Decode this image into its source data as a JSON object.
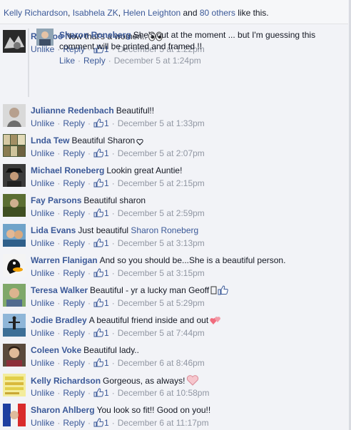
{
  "likes_bar": {
    "names": [
      "Kelly Richardson",
      "Isabhela ZK",
      "Helen Leighton"
    ],
    "sep1": ", ",
    "sep2": ", ",
    "and": " and ",
    "others": "80 others",
    "suffix": " like this."
  },
  "actions": {
    "unlike": "Unlike",
    "reply": "Reply",
    "like": "Like"
  },
  "comments": [
    {
      "author": "Ric Doo",
      "text": "Now that's a women..",
      "likes": "1",
      "date": "December 5 at 1:22pm",
      "emoji": "eyes"
    },
    {
      "author": "Sharon Roneberg",
      "text": "She's out at the moment ... but I'm guessing this comment will be printed and framed !!",
      "date": "December 5 at 1:24pm"
    },
    {
      "author": "Julianne Redenbach",
      "text": "Beautiful!!",
      "likes": "1",
      "date": "December 5 at 1:33pm"
    },
    {
      "author": "Lnda Tew",
      "text": "Beautiful Sharon",
      "likes": "1",
      "date": "December 5 at 2:07pm",
      "emoji": "heart-outline"
    },
    {
      "author": "Michael Roneberg",
      "text": "Lookin great Auntie!",
      "likes": "1",
      "date": "December 5 at 2:15pm"
    },
    {
      "author": "Fay Parsons",
      "text": "Beautiful sharon",
      "likes": "1",
      "date": "December 5 at 2:59pm"
    },
    {
      "author": "Lida Evans",
      "text": "Just beautiful",
      "mention": "Sharon Roneberg",
      "likes": "1",
      "date": "December 5 at 3:13pm"
    },
    {
      "author": "Warren Flanigan",
      "text": "And so you should be...She is a beautiful person.",
      "likes": "1",
      "date": "December 5 at 3:15pm"
    },
    {
      "author": "Teresa Walker",
      "text": "Beautiful - yr a lucky man Geoff",
      "likes": "1",
      "date": "December 5 at 5:29pm",
      "emoji": "thumbs-up"
    },
    {
      "author": "Jodie Bradley",
      "text": "A beautiful friend inside and out",
      "likes": "1",
      "date": "December 5 at 7:44pm",
      "emoji": "hearts"
    },
    {
      "author": "Coleen Voke",
      "text": "Beautiful lady..",
      "likes": "1",
      "date": "December 6 at 8:46pm"
    },
    {
      "author": "Kelly Richardson",
      "text": "Gorgeous, as always!",
      "likes": "1",
      "date": "December 6 at 10:58pm",
      "emoji": "heart"
    },
    {
      "author": "Sharon Ahlberg",
      "text": "You look so fit!! Good on you!!",
      "likes": "1",
      "date": "December 6 at 11:17pm"
    }
  ],
  "colors": {
    "link": "#3b5998",
    "meta": "#9197a3",
    "text": "#141823",
    "background": "#f2f3f7"
  }
}
